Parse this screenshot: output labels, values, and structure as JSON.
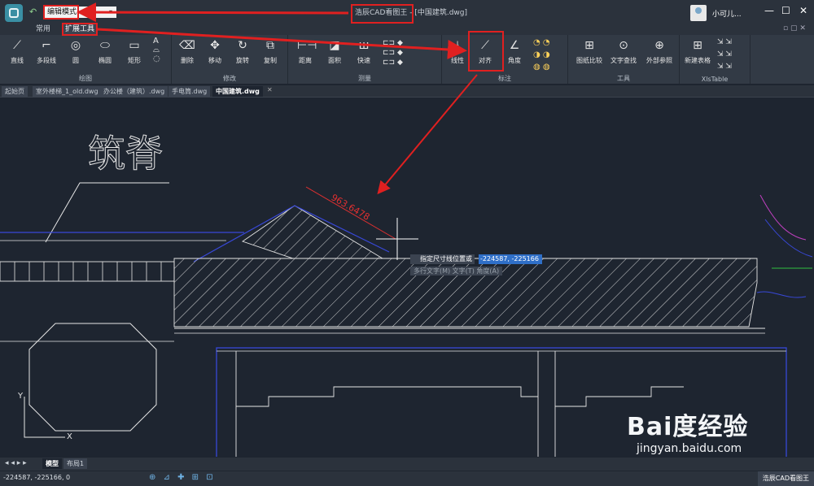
{
  "titlebar": {
    "mode_value": "编辑模式",
    "window_title": "浩辰CAD看图王 - [中国建筑.dwg]",
    "username": "小可儿..."
  },
  "menu_tabs": [
    {
      "label": "常用"
    },
    {
      "label": "扩展工具"
    }
  ],
  "ribbon": {
    "draw": {
      "label": "绘图",
      "line": "直线",
      "polyline": "多段线",
      "circle": "圆",
      "ellipse": "椭圆",
      "rect": "矩形"
    },
    "modify": {
      "label": "修改",
      "delete": "删除",
      "move": "移动",
      "rotate": "旋转",
      "copy": "复制"
    },
    "measure": {
      "label": "测量",
      "distance": "距离",
      "area": "面积",
      "quick": "快速"
    },
    "dim": {
      "label": "标注",
      "linear": "线性",
      "aligned": "对齐",
      "angle": "角度"
    },
    "tools": {
      "label": "工具",
      "compare": "图纸比较",
      "find": "文字查找",
      "xref": "外部参照"
    },
    "xls": {
      "label": "XlsTable",
      "new": "新建表格"
    }
  },
  "doc_tabs": [
    {
      "label": "起始页"
    },
    {
      "label": "室外楼梯_1_old.dwg"
    },
    {
      "label": "办公楼（建筑）.dwg"
    },
    {
      "label": "手电筒.dwg"
    },
    {
      "label": "中国建筑.dwg"
    }
  ],
  "drawing": {
    "title_text": "筑脊",
    "dim_value": "963.6478"
  },
  "dim_prompt": {
    "label": "指定尺寸线位置或",
    "value": "-224587, -225166",
    "options": "多行文字(M)  文字(T)  角度(A)"
  },
  "layout_tabs": [
    {
      "label": "模型"
    },
    {
      "label": "布局1"
    }
  ],
  "status": {
    "coords": "-224587, -225166, 0",
    "brand": "浩辰CAD看图王"
  },
  "watermark": {
    "main": "Bai度经验",
    "sub": "jingyan.baidu.com"
  }
}
